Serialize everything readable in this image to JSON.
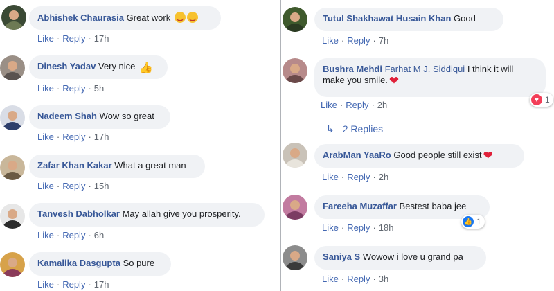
{
  "left_comments": [
    {
      "author": "Abhishek Chaurasia",
      "tag": "",
      "text": "Great work",
      "emoji": "smile2",
      "time": "17h",
      "avatar_color": "#3b4a35"
    },
    {
      "author": "Dinesh Yadav",
      "tag": "",
      "text": "Very nice",
      "emoji": "thumb",
      "time": "5h",
      "avatar_color": "#7a6f66"
    },
    {
      "author": "Nadeem Shah",
      "tag": "",
      "text": "Wow so great",
      "emoji": "",
      "time": "17h",
      "avatar_color": "#2e3f6b"
    },
    {
      "author": "Zafar Khan Kakar",
      "tag": "",
      "text": "What a great man",
      "emoji": "",
      "time": "15h",
      "avatar_color": "#a88f6a"
    },
    {
      "author": "Tanvesh Dabholkar",
      "tag": "",
      "text": "May allah give you prosperity.",
      "emoji": "",
      "time": "6h",
      "avatar_color": "#2b2b2b"
    },
    {
      "author": "Kamalika Dasgupta",
      "tag": "",
      "text": "So pure",
      "emoji": "",
      "time": "17h",
      "avatar_color": "#8a3b5a"
    }
  ],
  "right_comments": [
    {
      "author": "Tutul Shakhawat Husain Khan",
      "tag": "",
      "text": "Good",
      "time": "7h",
      "avatar_color": "#3f5a2d"
    },
    {
      "author": "Bushra Mehdi",
      "tag": "Farhat M J. Siddiqui",
      "text": "I think it will make you smile.",
      "time": "2h",
      "avatar_color": "#6b4a4a",
      "reaction": {
        "type": "love",
        "count": "1"
      }
    },
    {
      "author": "ArabMan YaaRo",
      "tag": "",
      "text": "Good people still exist",
      "time": "2h",
      "avatar_color": "#c9c2b8"
    },
    {
      "author": "Fareeha Muzaffar",
      "tag": "",
      "text": "Bestest baba jee",
      "time": "18h",
      "avatar_color": "#7b3b62",
      "reaction": {
        "type": "like",
        "count": "1"
      }
    },
    {
      "author": "Saniya S",
      "tag": "",
      "text": "Wowow i love u grand pa",
      "time": "3h",
      "avatar_color": "#5b5b5b"
    }
  ],
  "replies_label": "2 Replies",
  "actions": {
    "like": "Like",
    "reply": "Reply",
    "sep": "·"
  }
}
